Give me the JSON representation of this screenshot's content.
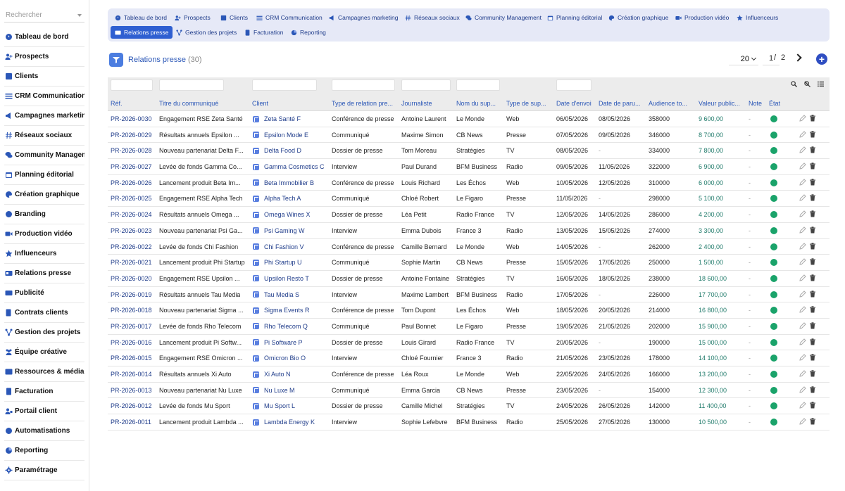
{
  "sidebar": {
    "search_placeholder": "Rechercher",
    "items": [
      {
        "label": "Tableau de bord",
        "icon": "dashboard-icon"
      },
      {
        "label": "Prospects",
        "icon": "user-plus-icon"
      },
      {
        "label": "Clients",
        "icon": "clients-icon"
      },
      {
        "label": "CRM Communication",
        "icon": "crm-icon"
      },
      {
        "label": "Campagnes marketing",
        "icon": "megaphone-icon"
      },
      {
        "label": "Réseaux sociaux",
        "icon": "hashtag-icon"
      },
      {
        "label": "Community Management",
        "icon": "comments-icon"
      },
      {
        "label": "Planning éditorial",
        "icon": "calendar-icon"
      },
      {
        "label": "Création graphique",
        "icon": "palette-icon"
      },
      {
        "label": "Branding",
        "icon": "branding-icon"
      },
      {
        "label": "Production vidéo",
        "icon": "video-icon"
      },
      {
        "label": "Influenceurs",
        "icon": "star-icon"
      },
      {
        "label": "Relations presse",
        "icon": "press-icon"
      },
      {
        "label": "Publicité",
        "icon": "ad-icon"
      },
      {
        "label": "Contrats clients",
        "icon": "contract-icon"
      },
      {
        "label": "Gestion des projets",
        "icon": "project-icon"
      },
      {
        "label": "Équipe créative",
        "icon": "team-icon"
      },
      {
        "label": "Ressources & médias",
        "icon": "media-icon"
      },
      {
        "label": "Facturation",
        "icon": "invoice-icon"
      },
      {
        "label": "Portail client",
        "icon": "portal-icon"
      },
      {
        "label": "Automatisations",
        "icon": "automation-icon"
      },
      {
        "label": "Reporting",
        "icon": "reporting-icon"
      },
      {
        "label": "Paramétrage",
        "icon": "gear-icon"
      }
    ]
  },
  "tabs": [
    {
      "label": "Tableau de bord",
      "icon": "dashboard-icon",
      "active": false
    },
    {
      "label": "Prospects",
      "icon": "user-plus-icon",
      "active": false
    },
    {
      "label": "Clients",
      "icon": "clients-icon",
      "active": false
    },
    {
      "label": "CRM Communication",
      "icon": "crm-icon",
      "active": false
    },
    {
      "label": "Campagnes marketing",
      "icon": "megaphone-icon",
      "active": false
    },
    {
      "label": "Réseaux sociaux",
      "icon": "hashtag-icon",
      "active": false
    },
    {
      "label": "Community Management",
      "icon": "comments-icon",
      "active": false
    },
    {
      "label": "Planning éditorial",
      "icon": "calendar-icon",
      "active": false
    },
    {
      "label": "Création graphique",
      "icon": "palette-icon",
      "active": false
    },
    {
      "label": "Production vidéo",
      "icon": "video-icon",
      "active": false
    },
    {
      "label": "Influenceurs",
      "icon": "star-icon",
      "active": false
    },
    {
      "label": "Relations presse",
      "icon": "press-icon",
      "active": true
    },
    {
      "label": "Gestion des projets",
      "icon": "project-icon",
      "active": false
    },
    {
      "label": "Facturation",
      "icon": "invoice-icon",
      "active": false
    },
    {
      "label": "Reporting",
      "icon": "reporting-icon",
      "active": false
    }
  ],
  "header": {
    "title": "Relations presse",
    "count": "(30)",
    "page_size": "20",
    "page_current": "1",
    "page_sep": "/",
    "page_total": "2",
    "add_label": "+"
  },
  "colors": {
    "accent": "#2f5fd1",
    "link": "#1f3c8a",
    "value": "#1f7a6a",
    "status_ok": "#1aa36a"
  },
  "table": {
    "columns": [
      "Réf.",
      "Titre du communiqué",
      "Client",
      "Type de relation pre...",
      "Journaliste",
      "Nom du sup...",
      "Type de sup...",
      "Date d'envoi",
      "Date de paru...",
      "Audience to...",
      "Valeur public...",
      "Note",
      "État"
    ],
    "rows": [
      [
        "PR-2026-0030",
        "Engagement RSE Zeta Santé",
        "Zeta Santé F",
        "Conférence de presse",
        "Antoine Laurent",
        "Le Monde",
        "Web",
        "06/05/2026",
        "08/05/2026",
        "358000",
        "9 600,00",
        "-"
      ],
      [
        "PR-2026-0029",
        "Résultats annuels Epsilon ...",
        "Epsilon Mode E",
        "Communiqué",
        "Maxime Simon",
        "CB News",
        "Presse",
        "07/05/2026",
        "09/05/2026",
        "346000",
        "8 700,00",
        "-"
      ],
      [
        "PR-2026-0028",
        "Nouveau partenariat Delta F...",
        "Delta Food D",
        "Dossier de presse",
        "Tom Moreau",
        "Stratégies",
        "TV",
        "08/05/2026",
        "-",
        "334000",
        "7 800,00",
        "-"
      ],
      [
        "PR-2026-0027",
        "Levée de fonds Gamma Co...",
        "Gamma Cosmetics C",
        "Interview",
        "Paul Durand",
        "BFM Business",
        "Radio",
        "09/05/2026",
        "11/05/2026",
        "322000",
        "6 900,00",
        "-"
      ],
      [
        "PR-2026-0026",
        "Lancement produit Beta Im...",
        "Beta Immobilier B",
        "Conférence de presse",
        "Louis Richard",
        "Les Échos",
        "Web",
        "10/05/2026",
        "12/05/2026",
        "310000",
        "6 000,00",
        "-"
      ],
      [
        "PR-2026-0025",
        "Engagement RSE Alpha Tech",
        "Alpha Tech A",
        "Communiqué",
        "Chloé Robert",
        "Le Figaro",
        "Presse",
        "11/05/2026",
        "-",
        "298000",
        "5 100,00",
        "-"
      ],
      [
        "PR-2026-0024",
        "Résultats annuels Omega ...",
        "Omega Wines X",
        "Dossier de presse",
        "Léa Petit",
        "Radio France",
        "TV",
        "12/05/2026",
        "14/05/2026",
        "286000",
        "4 200,00",
        "-"
      ],
      [
        "PR-2026-0023",
        "Nouveau partenariat Psi Ga...",
        "Psi Gaming W",
        "Interview",
        "Emma Dubois",
        "France 3",
        "Radio",
        "13/05/2026",
        "15/05/2026",
        "274000",
        "3 300,00",
        "-"
      ],
      [
        "PR-2026-0022",
        "Levée de fonds Chi Fashion",
        "Chi Fashion V",
        "Conférence de presse",
        "Camille Bernard",
        "Le Monde",
        "Web",
        "14/05/2026",
        "-",
        "262000",
        "2 400,00",
        "-"
      ],
      [
        "PR-2026-0021",
        "Lancement produit Phi Startup",
        "Phi Startup U",
        "Communiqué",
        "Sophie Martin",
        "CB News",
        "Presse",
        "15/05/2026",
        "17/05/2026",
        "250000",
        "1 500,00",
        "-"
      ],
      [
        "PR-2026-0020",
        "Engagement RSE Upsilon ...",
        "Upsilon Resto T",
        "Dossier de presse",
        "Antoine Fontaine",
        "Stratégies",
        "TV",
        "16/05/2026",
        "18/05/2026",
        "238000",
        "18 600,00",
        "-"
      ],
      [
        "PR-2026-0019",
        "Résultats annuels Tau Media",
        "Tau Media S",
        "Interview",
        "Maxime Lambert",
        "BFM Business",
        "Radio",
        "17/05/2026",
        "-",
        "226000",
        "17 700,00",
        "-"
      ],
      [
        "PR-2026-0018",
        "Nouveau partenariat Sigma ...",
        "Sigma Events R",
        "Conférence de presse",
        "Tom Dupont",
        "Les Échos",
        "Web",
        "18/05/2026",
        "20/05/2026",
        "214000",
        "16 800,00",
        "-"
      ],
      [
        "PR-2026-0017",
        "Levée de fonds Rho Telecom",
        "Rho Telecom Q",
        "Communiqué",
        "Paul Bonnet",
        "Le Figaro",
        "Presse",
        "19/05/2026",
        "21/05/2026",
        "202000",
        "15 900,00",
        "-"
      ],
      [
        "PR-2026-0016",
        "Lancement produit Pi Softw...",
        "Pi Software P",
        "Dossier de presse",
        "Louis Girard",
        "Radio France",
        "TV",
        "20/05/2026",
        "-",
        "190000",
        "15 000,00",
        "-"
      ],
      [
        "PR-2026-0015",
        "Engagement RSE Omicron ...",
        "Omicron Bio O",
        "Interview",
        "Chloé Fournier",
        "France 3",
        "Radio",
        "21/05/2026",
        "23/05/2026",
        "178000",
        "14 100,00",
        "-"
      ],
      [
        "PR-2026-0014",
        "Résultats annuels Xi Auto",
        "Xi Auto N",
        "Conférence de presse",
        "Léa Roux",
        "Le Monde",
        "Web",
        "22/05/2026",
        "24/05/2026",
        "166000",
        "13 200,00",
        "-"
      ],
      [
        "PR-2026-0013",
        "Nouveau partenariat Nu Luxe",
        "Nu Luxe M",
        "Communiqué",
        "Emma Garcia",
        "CB News",
        "Presse",
        "23/05/2026",
        "-",
        "154000",
        "12 300,00",
        "-"
      ],
      [
        "PR-2026-0012",
        "Levée de fonds Mu Sport",
        "Mu Sport L",
        "Dossier de presse",
        "Camille Michel",
        "Stratégies",
        "TV",
        "24/05/2026",
        "26/05/2026",
        "142000",
        "11 400,00",
        "-"
      ],
      [
        "PR-2026-0011",
        "Lancement produit Lambda ...",
        "Lambda Energy K",
        "Interview",
        "Sophie Lefebvre",
        "BFM Business",
        "Radio",
        "25/05/2026",
        "27/05/2026",
        "130000",
        "10 500,00",
        "-"
      ]
    ]
  }
}
